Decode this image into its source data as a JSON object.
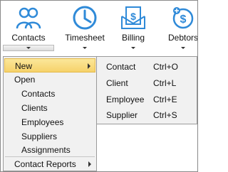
{
  "ribbon": {
    "contacts": {
      "label": "Contacts",
      "icon": "people-icon"
    },
    "timesheet": {
      "label": "Timesheet",
      "icon": "clock-icon"
    },
    "billing": {
      "label": "Billing",
      "icon": "invoice-dollar-icon"
    },
    "debtors": {
      "label": "Debtors",
      "icon": "debtors-icon"
    }
  },
  "menu": {
    "new": "New",
    "open": "Open",
    "open_items": [
      "Contacts",
      "Clients",
      "Employees",
      "Suppliers",
      "Assignments"
    ],
    "contact_reports": "Contact Reports"
  },
  "new_submenu": [
    {
      "label": "Contact",
      "shortcut": "Ctrl+O"
    },
    {
      "label": "Client",
      "shortcut": "Ctrl+L"
    },
    {
      "label": "Employee",
      "shortcut": "Ctrl+E"
    },
    {
      "label": "Supplier",
      "shortcut": "Ctrl+S"
    }
  ],
  "colors": {
    "icon_blue": "#2f8ad8",
    "highlight": "#f6d26a"
  }
}
